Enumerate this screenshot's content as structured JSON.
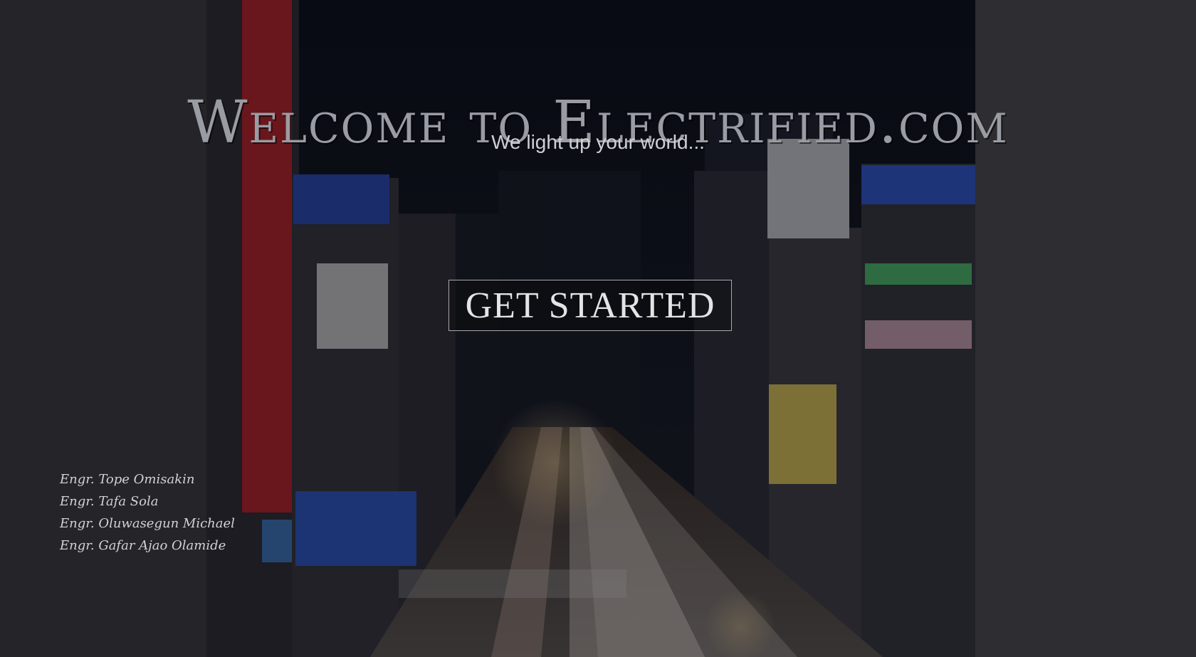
{
  "hero": {
    "title": "Welcome to Electrified.com",
    "subtitle": "We light up your world...",
    "cta_label": "GET STARTED"
  },
  "credits": [
    "Engr. Tope Omisakin",
    "Engr. Tafa Sola",
    "Engr. Oluwasegun Michael",
    "Engr. Gafar Ajao Olamide"
  ],
  "colors": {
    "title": "#9a9ca3",
    "subtitle": "#cfd0d4",
    "button_border": "#a9a9ad",
    "overlay": "#0b0e16"
  }
}
